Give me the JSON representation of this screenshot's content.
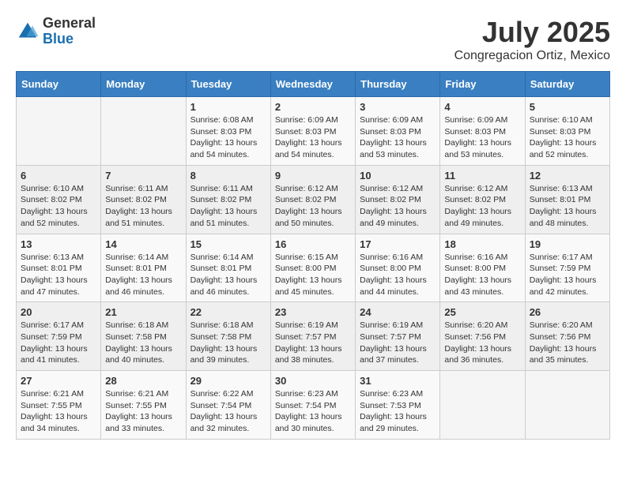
{
  "header": {
    "logo_general": "General",
    "logo_blue": "Blue",
    "month": "July 2025",
    "location": "Congregacion Ortiz, Mexico"
  },
  "weekdays": [
    "Sunday",
    "Monday",
    "Tuesday",
    "Wednesday",
    "Thursday",
    "Friday",
    "Saturday"
  ],
  "weeks": [
    [
      {
        "day": "",
        "info": ""
      },
      {
        "day": "",
        "info": ""
      },
      {
        "day": "1",
        "sunrise": "6:08 AM",
        "sunset": "8:03 PM",
        "daylight": "13 hours and 54 minutes."
      },
      {
        "day": "2",
        "sunrise": "6:09 AM",
        "sunset": "8:03 PM",
        "daylight": "13 hours and 54 minutes."
      },
      {
        "day": "3",
        "sunrise": "6:09 AM",
        "sunset": "8:03 PM",
        "daylight": "13 hours and 53 minutes."
      },
      {
        "day": "4",
        "sunrise": "6:09 AM",
        "sunset": "8:03 PM",
        "daylight": "13 hours and 53 minutes."
      },
      {
        "day": "5",
        "sunrise": "6:10 AM",
        "sunset": "8:03 PM",
        "daylight": "13 hours and 52 minutes."
      }
    ],
    [
      {
        "day": "6",
        "sunrise": "6:10 AM",
        "sunset": "8:02 PM",
        "daylight": "13 hours and 52 minutes."
      },
      {
        "day": "7",
        "sunrise": "6:11 AM",
        "sunset": "8:02 PM",
        "daylight": "13 hours and 51 minutes."
      },
      {
        "day": "8",
        "sunrise": "6:11 AM",
        "sunset": "8:02 PM",
        "daylight": "13 hours and 51 minutes."
      },
      {
        "day": "9",
        "sunrise": "6:12 AM",
        "sunset": "8:02 PM",
        "daylight": "13 hours and 50 minutes."
      },
      {
        "day": "10",
        "sunrise": "6:12 AM",
        "sunset": "8:02 PM",
        "daylight": "13 hours and 49 minutes."
      },
      {
        "day": "11",
        "sunrise": "6:12 AM",
        "sunset": "8:02 PM",
        "daylight": "13 hours and 49 minutes."
      },
      {
        "day": "12",
        "sunrise": "6:13 AM",
        "sunset": "8:01 PM",
        "daylight": "13 hours and 48 minutes."
      }
    ],
    [
      {
        "day": "13",
        "sunrise": "6:13 AM",
        "sunset": "8:01 PM",
        "daylight": "13 hours and 47 minutes."
      },
      {
        "day": "14",
        "sunrise": "6:14 AM",
        "sunset": "8:01 PM",
        "daylight": "13 hours and 46 minutes."
      },
      {
        "day": "15",
        "sunrise": "6:14 AM",
        "sunset": "8:01 PM",
        "daylight": "13 hours and 46 minutes."
      },
      {
        "day": "16",
        "sunrise": "6:15 AM",
        "sunset": "8:00 PM",
        "daylight": "13 hours and 45 minutes."
      },
      {
        "day": "17",
        "sunrise": "6:16 AM",
        "sunset": "8:00 PM",
        "daylight": "13 hours and 44 minutes."
      },
      {
        "day": "18",
        "sunrise": "6:16 AM",
        "sunset": "8:00 PM",
        "daylight": "13 hours and 43 minutes."
      },
      {
        "day": "19",
        "sunrise": "6:17 AM",
        "sunset": "7:59 PM",
        "daylight": "13 hours and 42 minutes."
      }
    ],
    [
      {
        "day": "20",
        "sunrise": "6:17 AM",
        "sunset": "7:59 PM",
        "daylight": "13 hours and 41 minutes."
      },
      {
        "day": "21",
        "sunrise": "6:18 AM",
        "sunset": "7:58 PM",
        "daylight": "13 hours and 40 minutes."
      },
      {
        "day": "22",
        "sunrise": "6:18 AM",
        "sunset": "7:58 PM",
        "daylight": "13 hours and 39 minutes."
      },
      {
        "day": "23",
        "sunrise": "6:19 AM",
        "sunset": "7:57 PM",
        "daylight": "13 hours and 38 minutes."
      },
      {
        "day": "24",
        "sunrise": "6:19 AM",
        "sunset": "7:57 PM",
        "daylight": "13 hours and 37 minutes."
      },
      {
        "day": "25",
        "sunrise": "6:20 AM",
        "sunset": "7:56 PM",
        "daylight": "13 hours and 36 minutes."
      },
      {
        "day": "26",
        "sunrise": "6:20 AM",
        "sunset": "7:56 PM",
        "daylight": "13 hours and 35 minutes."
      }
    ],
    [
      {
        "day": "27",
        "sunrise": "6:21 AM",
        "sunset": "7:55 PM",
        "daylight": "13 hours and 34 minutes."
      },
      {
        "day": "28",
        "sunrise": "6:21 AM",
        "sunset": "7:55 PM",
        "daylight": "13 hours and 33 minutes."
      },
      {
        "day": "29",
        "sunrise": "6:22 AM",
        "sunset": "7:54 PM",
        "daylight": "13 hours and 32 minutes."
      },
      {
        "day": "30",
        "sunrise": "6:23 AM",
        "sunset": "7:54 PM",
        "daylight": "13 hours and 30 minutes."
      },
      {
        "day": "31",
        "sunrise": "6:23 AM",
        "sunset": "7:53 PM",
        "daylight": "13 hours and 29 minutes."
      },
      {
        "day": "",
        "info": ""
      },
      {
        "day": "",
        "info": ""
      }
    ]
  ]
}
